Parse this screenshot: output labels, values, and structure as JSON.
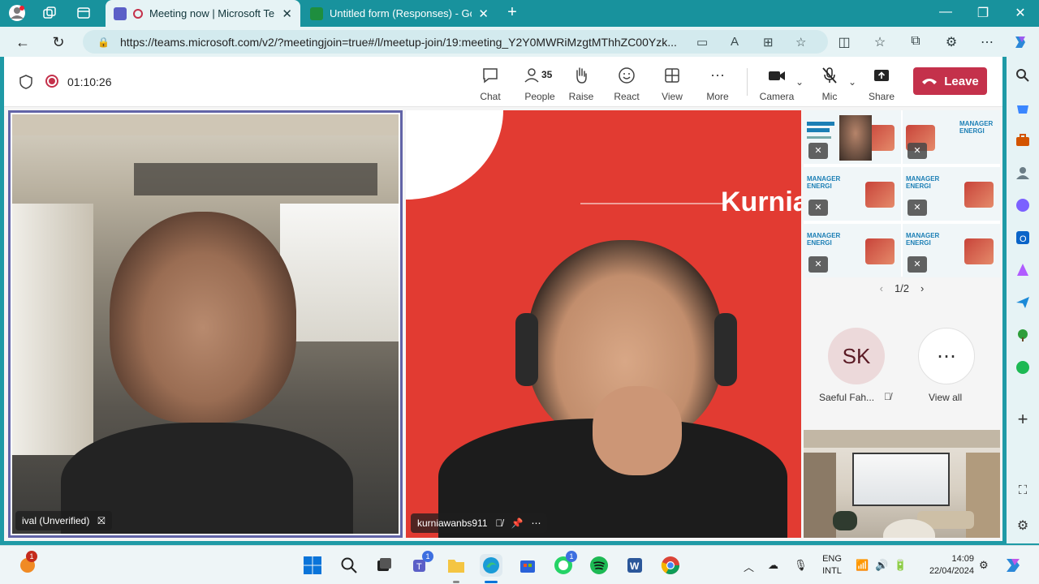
{
  "browser": {
    "tabs": [
      {
        "title": "Meeting now | Microsoft Te",
        "active": true
      },
      {
        "title": "Untitled form (Responses) - Goo",
        "active": false
      }
    ],
    "url": "https://teams.microsoft.com/v2/?meetingjoin=true#/l/meetup-join/19:meeting_Y2Y0MWRiMzgtMThhZC00Yzk..."
  },
  "meeting": {
    "timer": "01:10:26",
    "controls": {
      "chat": "Chat",
      "people": "People",
      "people_count": "35",
      "raise": "Raise",
      "react": "React",
      "view": "View",
      "more": "More",
      "camera": "Camera",
      "mic": "Mic",
      "share": "Share"
    },
    "leave_label": "Leave",
    "tiles": {
      "main_left_name": "ival (Unverified)",
      "main_right_name": "kurniawanbs911",
      "main_right_bg_text": "Kurnia"
    },
    "gallery": {
      "pager": "1/2",
      "slide_title": "MANAGER ENERGI"
    },
    "participants": [
      {
        "initials": "SK",
        "name": "Saeful Fah..."
      },
      {
        "initials": "⋯",
        "name": "View all"
      }
    ]
  },
  "taskbar": {
    "notification_badge": "1",
    "teams_badge": "1",
    "whatsapp_badge": "1",
    "language": [
      "ENG",
      "INTL"
    ],
    "time": "14:09",
    "date": "22/04/2024"
  },
  "colors": {
    "leave": "#c4314b",
    "active_border": "#6264a7",
    "browser_accent": "#18929d"
  }
}
